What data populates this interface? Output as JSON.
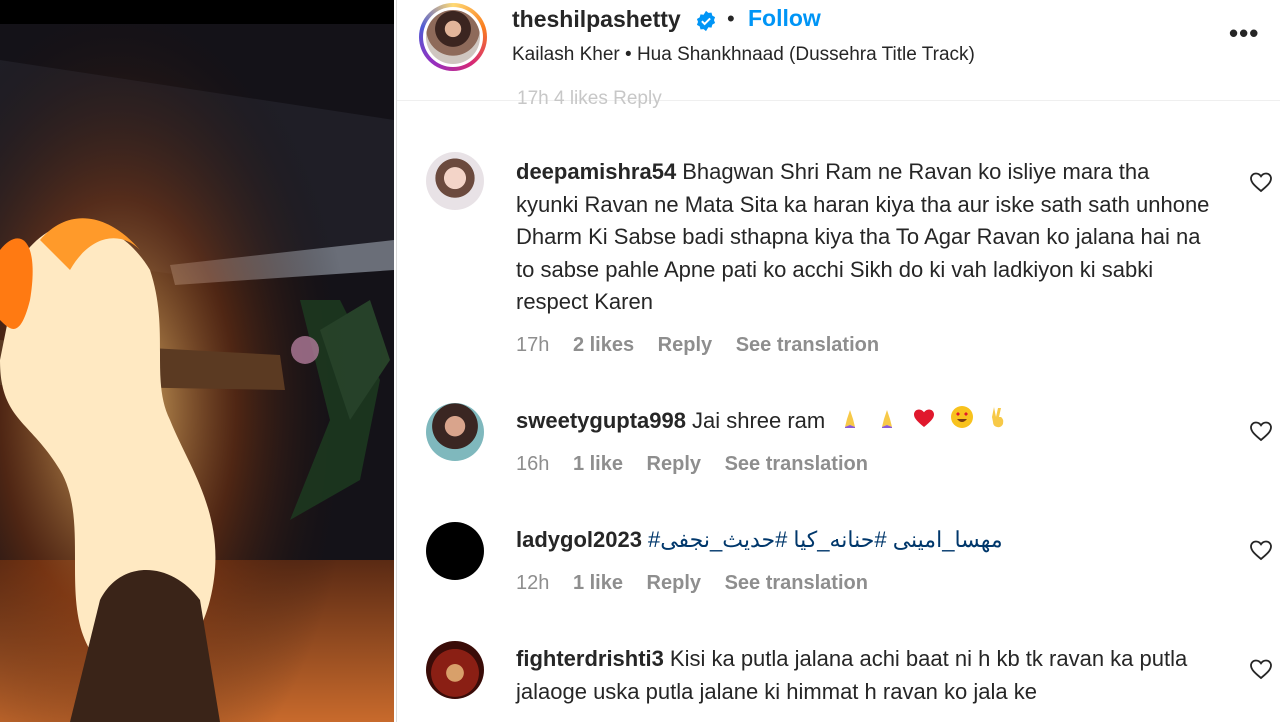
{
  "post": {
    "username": "theshilpashetty",
    "separator": "•",
    "follow_label": "Follow",
    "song_line": "Kailash Kher • Hua Shankhnaad (Dussehra Title Track)",
    "more_label": "•••",
    "previous_meta": "17h     4 likes     Reply"
  },
  "comments": [
    {
      "username": "deepamishra54",
      "text": "Bhagwan Shri Ram ne Ravan ko isliye mara tha kyunki Ravan ne Mata Sita ka haran kiya tha aur iske sath sath unhone Dharm Ki Sabse badi sthapna kiya tha To Agar Ravan ko jalana hai na to sabse pahle Apne pati ko acchi Sikh do ki vah ladkiyon ki sabki respect Karen",
      "time": "17h",
      "likes": "2 likes",
      "reply": "Reply",
      "translate": "See translation"
    },
    {
      "username": "sweetygupta998",
      "text": "Jai shree ram",
      "time": "16h",
      "likes": "1 like",
      "reply": "Reply",
      "translate": "See translation"
    },
    {
      "username": "ladygol2023",
      "text": "مهسا_امینی #حنانه_کیا #حدیث_نجفی#",
      "time": "12h",
      "likes": "1 like",
      "reply": "Reply",
      "translate": "See translation"
    },
    {
      "username": "fighterdrishti3",
      "text": "Kisi ka putla jalana achi baat ni h kb tk ravan ka putla jalaoge uska putla jalane ki himmat h ravan ko jala ke",
      "time": "",
      "likes": "",
      "reply": "",
      "translate": ""
    }
  ],
  "colors": {
    "follow": "#0095f6",
    "verified": "#0095f6",
    "meta": "#8e8e8e",
    "text": "#262626"
  }
}
